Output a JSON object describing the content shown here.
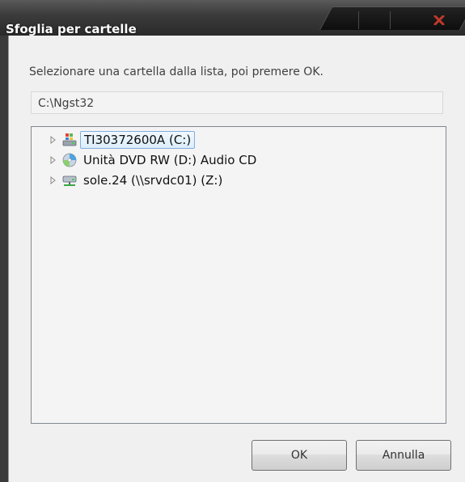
{
  "window": {
    "title": "Sfoglia per cartelle"
  },
  "dialog": {
    "description": "Selezionare una cartella dalla lista, poi premere OK.",
    "path_value": "C:\\Ngst32"
  },
  "tree": {
    "items": [
      {
        "label": "TI30372600A (C:)",
        "icon": "windows-drive-icon",
        "selected": true
      },
      {
        "label": "Unità DVD RW (D:) Audio CD",
        "icon": "cd-drive-icon",
        "selected": false
      },
      {
        "label": "sole.24 (\\\\srvdc01) (Z:)",
        "icon": "network-drive-icon",
        "selected": false
      }
    ]
  },
  "buttons": {
    "ok_label": "OK",
    "cancel_label": "Annulla"
  },
  "colors": {
    "titlebar": "#3c3c3c",
    "close_accent": "#c0392b",
    "selection_border": "#84acdd",
    "client_bg": "#f0f0f0"
  }
}
